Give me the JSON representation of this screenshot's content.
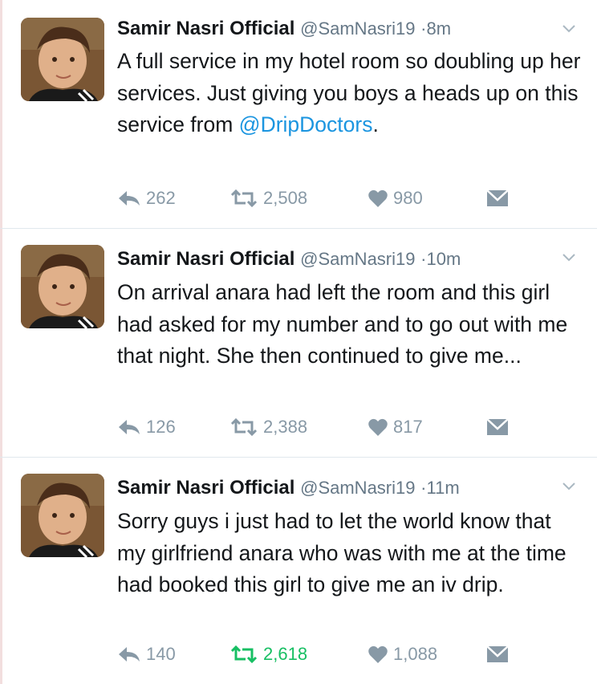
{
  "tweets": [
    {
      "name": "Samir Nasri Official",
      "handle": "@SamNasri19",
      "time": "8m",
      "text_before": "A full service in my hotel room so doubling up her services. Just giving you boys a heads up on this service from ",
      "mention": "@DripDoctors",
      "text_after": ".",
      "replies": "262",
      "retweets": "2,508",
      "likes": "980",
      "retweeted": false
    },
    {
      "name": "Samir Nasri Official",
      "handle": "@SamNasri19",
      "time": "10m",
      "text_before": "On arrival anara had left the room and this girl had asked for my number and to go out with me that night. She then continued to give me...",
      "mention": "",
      "text_after": "",
      "replies": "126",
      "retweets": "2,388",
      "likes": "817",
      "retweeted": false
    },
    {
      "name": "Samir Nasri Official",
      "handle": "@SamNasri19",
      "time": "11m",
      "text_before": "Sorry guys i just had to let the world know that my girlfriend anara who was with me at the time had booked this girl to give me an iv drip.",
      "mention": "",
      "text_after": "",
      "replies": "140",
      "retweets": "2,618",
      "likes": "1,088",
      "retweeted": true
    }
  ],
  "colors": {
    "mention": "#1b95e0",
    "action_gray": "#8899a6",
    "retweet_active": "#17bf63"
  },
  "icons": [
    "caret-down-icon",
    "reply-icon",
    "retweet-icon",
    "heart-icon",
    "direct-message-icon"
  ]
}
